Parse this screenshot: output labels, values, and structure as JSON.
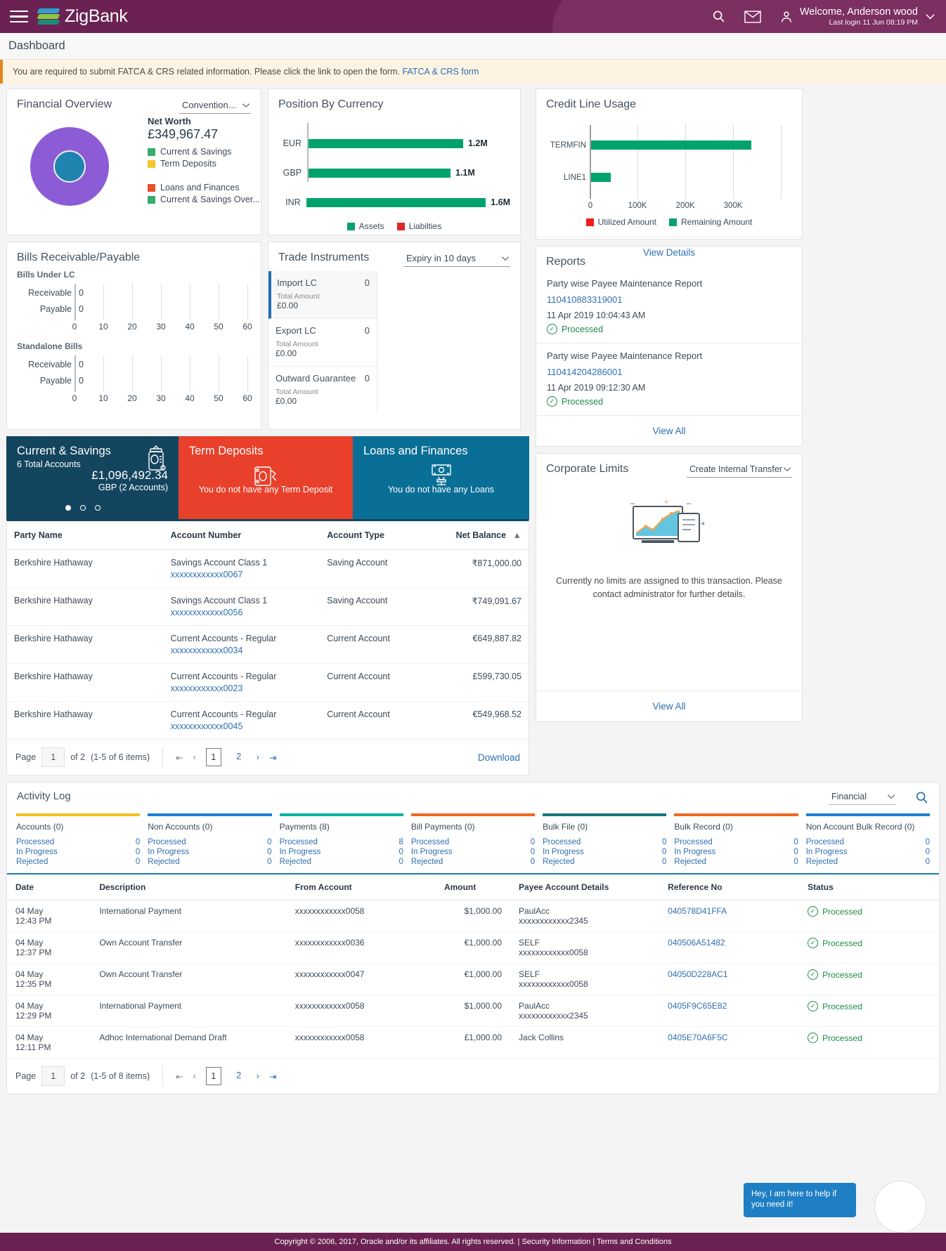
{
  "header": {
    "brand": "ZigBank",
    "menu_icon": "hamburger-icon",
    "search_icon": "search-icon",
    "mail_icon": "envelope-icon",
    "welcome": "Welcome, Anderson wood",
    "last_login": "Last login 11 Jun 08:19 PM"
  },
  "page_title": "Dashboard",
  "notice": {
    "text": "You are required to submit FATCA & CRS related information. Please click the link to open the form.",
    "link": "FATCA & CRS form"
  },
  "financial_overview": {
    "title": "Financial Overview",
    "selector": "Convention...",
    "net_worth_label": "Net Worth",
    "net_worth_value": "£349,967.47",
    "legend_top": [
      {
        "label": "Current & Savings",
        "color": "#3aab6e"
      },
      {
        "label": "Term Deposits",
        "color": "#f3c629"
      }
    ],
    "legend_bottom": [
      {
        "label": "Loans and Finances",
        "color": "#e8502a"
      },
      {
        "label": "Current & Savings Over...",
        "color": "#3aab6e"
      }
    ],
    "donut_outer_color": "#8b5cd6",
    "donut_inner_color": "#1f84b0"
  },
  "position_by_currency": {
    "title": "Position By Currency",
    "legend": [
      {
        "label": "Assets",
        "color": "#00a26d"
      },
      {
        "label": "Liabilties",
        "color": "#d92b2b"
      }
    ]
  },
  "credit_line_usage": {
    "title": "Credit Line Usage",
    "legend": [
      {
        "label": "Utilized Amount",
        "color": "#ef1b1b"
      },
      {
        "label": "Remaining Amount",
        "color": "#00a26d"
      }
    ],
    "view_details": "View Details"
  },
  "bills": {
    "title": "Bills Receivable/Payable",
    "section1": "Bills Under LC",
    "section2": "Standalone Bills"
  },
  "trade_instruments": {
    "title": "Trade Instruments",
    "selector": "Expiry in 10 days",
    "items": [
      {
        "name": "Import LC",
        "count": "0",
        "amount_label": "Total Amount",
        "amount": "£0.00"
      },
      {
        "name": "Export LC",
        "count": "0",
        "amount_label": "Total Amount",
        "amount": "£0.00"
      },
      {
        "name": "Outward Guarantee",
        "count": "0",
        "amount_label": "Total Amount",
        "amount": "£0.00"
      }
    ]
  },
  "reports": {
    "title": "Reports",
    "items": [
      {
        "name": "Party wise Payee Maintenance Report",
        "ref": "110410883319001",
        "date": "11 Apr 2019 10:04:43 AM",
        "status": "Processed"
      },
      {
        "name": "Party wise Payee Maintenance Report",
        "ref": "110414204286001",
        "date": "11 Apr 2019 09:12:30 AM",
        "status": "Processed"
      }
    ],
    "view_all": "View All"
  },
  "corporate_limits": {
    "title": "Corporate Limits",
    "selector": "Create Internal Transfer",
    "message": "Currently no limits are assigned to this transaction. Please contact administrator for further details.",
    "view_all": "View All"
  },
  "tiles": [
    {
      "title": "Current & Savings",
      "sub": "6 Total Accounts",
      "balance": "£1,096,492.34",
      "balance_sub": "GBP (2 Accounts)",
      "color": "#13455f",
      "icon": "piggy-bank-icon",
      "message": ""
    },
    {
      "title": "Term Deposits",
      "sub": "",
      "balance": "",
      "balance_sub": "",
      "color": "#e8402a",
      "icon": "deposit-box-icon",
      "message": "You do not have any Term Deposit"
    },
    {
      "title": "Loans and Finances",
      "sub": "",
      "balance": "",
      "balance_sub": "",
      "color": "#0a6f96",
      "icon": "loan-hand-icon",
      "message": "You do not have any Loans"
    }
  ],
  "accounts_table": {
    "columns": [
      "Party Name",
      "Account Number",
      "Account Type",
      "Net Balance"
    ],
    "rows": [
      {
        "party": "Berkshire Hathaway",
        "acct_name": "Savings Account Class 1",
        "acct_no": "xxxxxxxxxxxx0067",
        "type": "Saving Account",
        "balance": "₹871,000.00"
      },
      {
        "party": "Berkshire Hathaway",
        "acct_name": "Savings Account Class 1",
        "acct_no": "xxxxxxxxxxxx0056",
        "type": "Saving Account",
        "balance": "₹749,091.67"
      },
      {
        "party": "Berkshire Hathaway",
        "acct_name": "Current Accounts - Regular",
        "acct_no": "xxxxxxxxxxxx0034",
        "type": "Current Account",
        "balance": "€649,887.82"
      },
      {
        "party": "Berkshire Hathaway",
        "acct_name": "Current Accounts - Regular",
        "acct_no": "xxxxxxxxxxxx0023",
        "type": "Current Account",
        "balance": "£599,730.05"
      },
      {
        "party": "Berkshire Hathaway",
        "acct_name": "Current Accounts - Regular",
        "acct_no": "xxxxxxxxxxxx0045",
        "type": "Current Account",
        "balance": "€549,968.52"
      }
    ],
    "pager": {
      "page_label": "Page",
      "page_value": "1",
      "of": "of 2",
      "items": "(1-5 of 6 items)",
      "pages": [
        "1",
        "2"
      ],
      "current": "1",
      "download": "Download"
    }
  },
  "activity_log": {
    "title": "Activity Log",
    "selector": "Financial",
    "search_icon": "search-icon",
    "tabs": [
      {
        "label": "Accounts (0)",
        "color": "#f3c020",
        "rows": [
          [
            "Processed",
            "0"
          ],
          [
            "In Progress",
            "0"
          ],
          [
            "Rejected",
            "0"
          ]
        ]
      },
      {
        "label": "Non Accounts (0)",
        "color": "#1f7fd4",
        "rows": [
          [
            "Processed",
            "0"
          ],
          [
            "In Progress",
            "0"
          ],
          [
            "Rejected",
            "0"
          ]
        ]
      },
      {
        "label": "Payments (8)",
        "color": "#00b2a0",
        "rows": [
          [
            "Processed",
            "8"
          ],
          [
            "In Progress",
            "0"
          ],
          [
            "Rejected",
            "0"
          ]
        ]
      },
      {
        "label": "Bill Payments (0)",
        "color": "#f0681e",
        "rows": [
          [
            "Processed",
            "0"
          ],
          [
            "In Progress",
            "0"
          ],
          [
            "Rejected",
            "0"
          ]
        ]
      },
      {
        "label": "Bulk File (0)",
        "color": "#16747e",
        "rows": [
          [
            "Processed",
            "0"
          ],
          [
            "In Progress",
            "0"
          ],
          [
            "Rejected",
            "0"
          ]
        ]
      },
      {
        "label": "Bulk Record (0)",
        "color": "#f0681e",
        "rows": [
          [
            "Processed",
            "0"
          ],
          [
            "In Progress",
            "0"
          ],
          [
            "Rejected",
            "0"
          ]
        ]
      },
      {
        "label": "Non Account Bulk Record (0)",
        "color": "#1f7fd4",
        "rows": [
          [
            "Processed",
            "0"
          ],
          [
            "In Progress",
            "0"
          ],
          [
            "Rejected",
            "0"
          ]
        ]
      }
    ],
    "columns": [
      "Date",
      "Description",
      "From Account",
      "Amount",
      "Payee Account Details",
      "Reference No",
      "Status"
    ],
    "rows": [
      {
        "date": "04 May",
        "time": "12:43 PM",
        "desc": "International Payment",
        "from": "xxxxxxxxxxxx0058",
        "amount": "$1,000.00",
        "payee1": "PaulAcc",
        "payee2": "xxxxxxxxxxxx2345",
        "ref": "040578D41FFA",
        "status": "Processed"
      },
      {
        "date": "04 May",
        "time": "12:37 PM",
        "desc": "Own Account Transfer",
        "from": "xxxxxxxxxxxx0036",
        "amount": "€1,000.00",
        "payee1": "SELF",
        "payee2": "xxxxxxxxxxxx0058",
        "ref": "040506A51482",
        "status": "Processed"
      },
      {
        "date": "04 May",
        "time": "12:35 PM",
        "desc": "Own Account Transfer",
        "from": "xxxxxxxxxxxx0047",
        "amount": "€1,000.00",
        "payee1": "SELF",
        "payee2": "xxxxxxxxxxxx0058",
        "ref": "04050D228AC1",
        "status": "Processed"
      },
      {
        "date": "04 May",
        "time": "12:29 PM",
        "desc": "International Payment",
        "from": "xxxxxxxxxxxx0058",
        "amount": "$1,000.00",
        "payee1": "PaulAcc",
        "payee2": "xxxxxxxxxxxx2345",
        "ref": "0405F9C65E82",
        "status": "Processed"
      },
      {
        "date": "04 May",
        "time": "12:11 PM",
        "desc": "Adhoc International Demand Draft",
        "from": "xxxxxxxxxxxx0058",
        "amount": "£1,000.00",
        "payee1": "Jack Collins",
        "payee2": "",
        "ref": "0405E70A6F5C",
        "status": "Processed"
      }
    ],
    "pager": {
      "page_label": "Page",
      "page_value": "1",
      "of": "of 2",
      "items": "(1-5 of 8 items)",
      "pages": [
        "1",
        "2"
      ],
      "current": "1"
    }
  },
  "chat": {
    "text": "Hey, I am here to help if you need it!"
  },
  "footer": {
    "copyright": "Copyright © 2006, 2017, Oracle and/or its affiliates. All rights reserved. |",
    "link1": "Security Information",
    "sep": "|",
    "link2": "Terms and Conditions"
  },
  "chart_data": [
    {
      "type": "bar",
      "title": "Position By Currency",
      "orientation": "horizontal",
      "categories": [
        "EUR",
        "GBP",
        "INR"
      ],
      "series": [
        {
          "name": "Assets",
          "values": [
            1200000,
            1100000,
            1600000
          ]
        }
      ],
      "data_labels": [
        "1.2M",
        "1.1M",
        "1.6M"
      ],
      "legend": [
        "Assets",
        "Liabilties"
      ],
      "legend_position": "bottom",
      "colors": {
        "Assets": "#00a26d",
        "Liabilties": "#d92b2b"
      },
      "xlabel": "",
      "ylabel": "",
      "grid": false
    },
    {
      "type": "bar",
      "title": "Credit Line Usage",
      "orientation": "horizontal",
      "categories": [
        "TERMFIN",
        "LINE1"
      ],
      "series": [
        {
          "name": "Utilized Amount",
          "values": [
            0,
            0
          ]
        },
        {
          "name": "Remaining Amount",
          "values": [
            335000,
            40000
          ]
        }
      ],
      "xticks": [
        0,
        100000,
        200000,
        300000
      ],
      "xtick_labels": [
        "0",
        "100K",
        "200K",
        "300K"
      ],
      "xlim": [
        0,
        340000
      ],
      "legend": [
        "Utilized Amount",
        "Remaining Amount"
      ],
      "legend_position": "bottom",
      "colors": {
        "Utilized Amount": "#ef1b1b",
        "Remaining Amount": "#00a26d"
      },
      "grid": true
    },
    {
      "type": "bar",
      "title": "Bills Under LC",
      "orientation": "horizontal",
      "categories": [
        "Receivable",
        "Payable"
      ],
      "values": [
        0,
        0
      ],
      "data_labels": [
        "0",
        "0"
      ],
      "xticks": [
        0,
        10,
        20,
        30,
        40,
        50,
        60
      ],
      "xtick_labels": [
        "0",
        "10",
        "20",
        "30",
        "40",
        "50",
        "60"
      ],
      "xlim": [
        0,
        60
      ],
      "grid": true
    },
    {
      "type": "bar",
      "title": "Standalone Bills",
      "orientation": "horizontal",
      "categories": [
        "Receivable",
        "Payable"
      ],
      "values": [
        0,
        0
      ],
      "data_labels": [
        "0",
        "0"
      ],
      "xticks": [
        0,
        10,
        20,
        30,
        40,
        50,
        60
      ],
      "xtick_labels": [
        "0",
        "10",
        "20",
        "30",
        "40",
        "50",
        "60"
      ],
      "xlim": [
        0,
        60
      ],
      "grid": true
    },
    {
      "type": "pie",
      "title": "Financial Overview",
      "labels": [
        "Current & Savings",
        "Term Deposits",
        "Loans and Finances",
        "Current & Savings Over..."
      ],
      "values": [
        100,
        0,
        0,
        0
      ],
      "colors": [
        "#8b5cd6",
        "#f3c629",
        "#e8502a",
        "#3aab6e"
      ],
      "center_label": "Net Worth",
      "center_value": "£349,967.47"
    }
  ]
}
